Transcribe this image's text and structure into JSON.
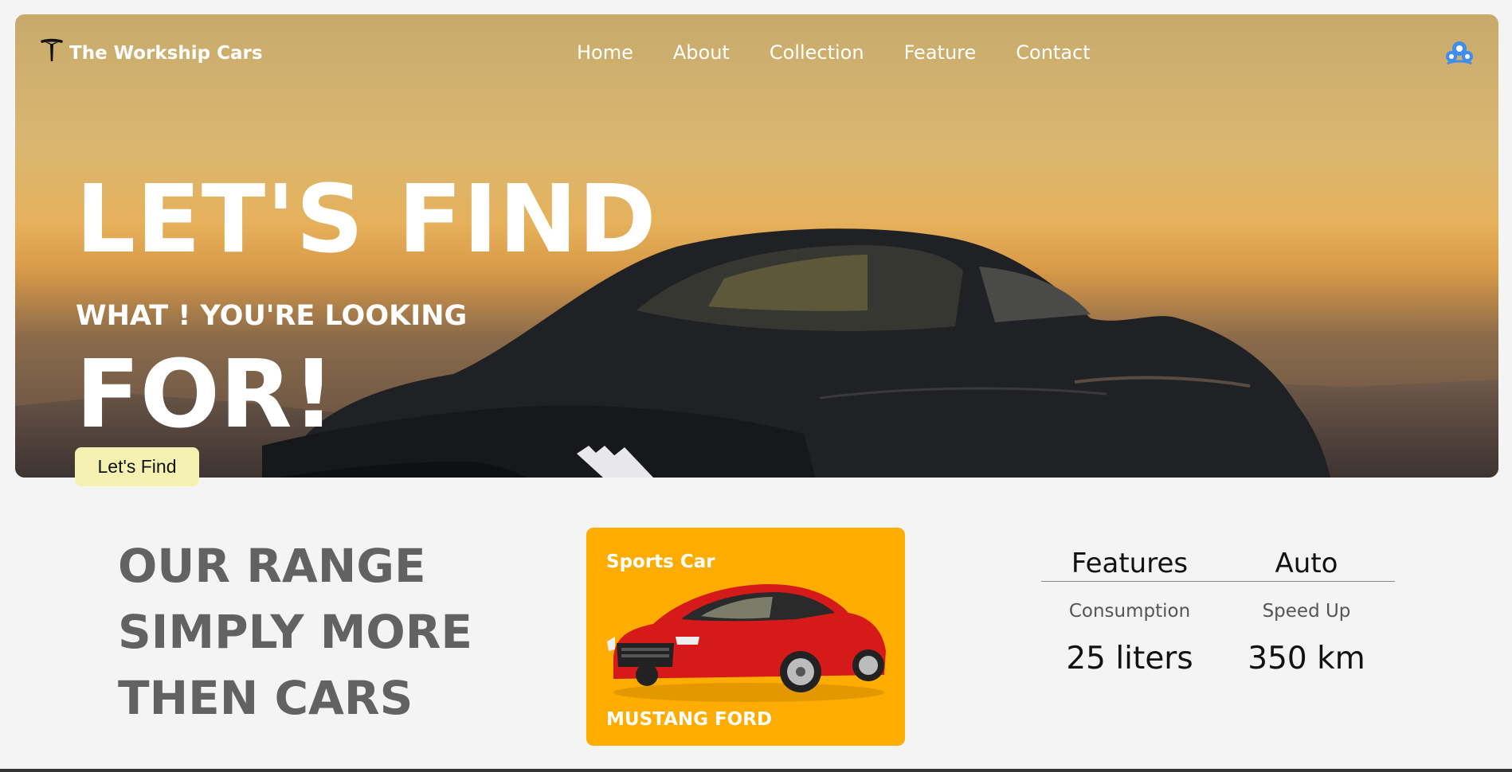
{
  "brand": {
    "name": "The Workship Cars",
    "logo_icon": "tesla-logo-icon"
  },
  "nav": {
    "items": [
      "Home",
      "About",
      "Collection",
      "Feature",
      "Contact"
    ],
    "user_icon": "user-group-icon"
  },
  "hero": {
    "headline_line1": "LET'S FIND",
    "subheadline": "WHAT ! YOU'RE LOOKING",
    "headline_line2": "FOR!",
    "cta_label": "Let's Find"
  },
  "range": {
    "lines": [
      "OUR RANGE",
      "SIMPLY MORE",
      "THEN CARS"
    ]
  },
  "card": {
    "type": "Sports Car",
    "name": "MUSTANG FORD",
    "background": "#fead00"
  },
  "specs": {
    "headers": [
      "Features",
      "Auto"
    ],
    "labels": [
      "Consumption",
      "Speed Up"
    ],
    "values": [
      "25 liters",
      "350 km"
    ]
  },
  "colors": {
    "cta_bg": "#f5f1b0",
    "range_text": "#626262"
  }
}
